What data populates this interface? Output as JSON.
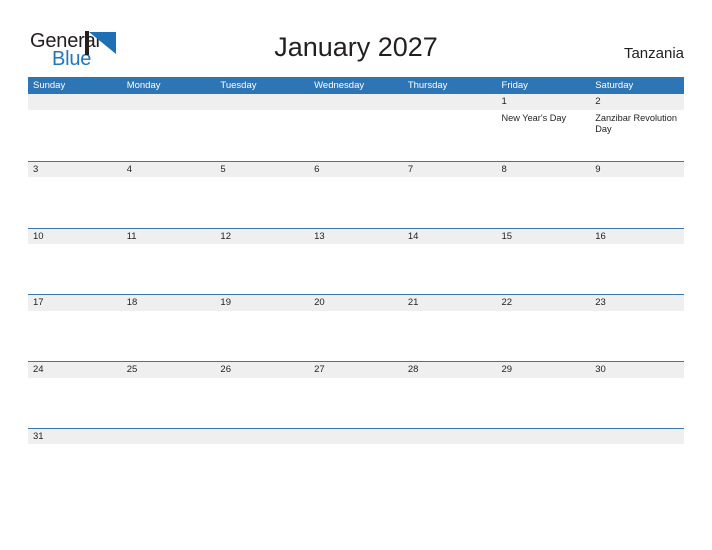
{
  "brand": {
    "name_part1": "General",
    "name_part2": "Blue",
    "mark_icon": "triangle-flag-icon",
    "colors": {
      "dark": "#231f20",
      "blue": "#2176bd"
    }
  },
  "header": {
    "title": "January 2027",
    "country": "Tanzania"
  },
  "calendar": {
    "accent_color": "#2e75b6",
    "band_color": "#efefef",
    "weekdays": [
      "Sunday",
      "Monday",
      "Tuesday",
      "Wednesday",
      "Thursday",
      "Friday",
      "Saturday"
    ],
    "weeks": [
      [
        {
          "day": "",
          "events": []
        },
        {
          "day": "",
          "events": []
        },
        {
          "day": "",
          "events": []
        },
        {
          "day": "",
          "events": []
        },
        {
          "day": "",
          "events": []
        },
        {
          "day": "1",
          "events": [
            "New Year's Day"
          ]
        },
        {
          "day": "2",
          "events": [
            "Zanzibar Revolution Day"
          ]
        }
      ],
      [
        {
          "day": "3",
          "events": []
        },
        {
          "day": "4",
          "events": []
        },
        {
          "day": "5",
          "events": []
        },
        {
          "day": "6",
          "events": []
        },
        {
          "day": "7",
          "events": []
        },
        {
          "day": "8",
          "events": []
        },
        {
          "day": "9",
          "events": []
        }
      ],
      [
        {
          "day": "10",
          "events": []
        },
        {
          "day": "11",
          "events": []
        },
        {
          "day": "12",
          "events": []
        },
        {
          "day": "13",
          "events": []
        },
        {
          "day": "14",
          "events": []
        },
        {
          "day": "15",
          "events": []
        },
        {
          "day": "16",
          "events": []
        }
      ],
      [
        {
          "day": "17",
          "events": []
        },
        {
          "day": "18",
          "events": []
        },
        {
          "day": "19",
          "events": []
        },
        {
          "day": "20",
          "events": []
        },
        {
          "day": "21",
          "events": []
        },
        {
          "day": "22",
          "events": []
        },
        {
          "day": "23",
          "events": []
        }
      ],
      [
        {
          "day": "24",
          "events": []
        },
        {
          "day": "25",
          "events": []
        },
        {
          "day": "26",
          "events": []
        },
        {
          "day": "27",
          "events": []
        },
        {
          "day": "28",
          "events": []
        },
        {
          "day": "29",
          "events": []
        },
        {
          "day": "30",
          "events": []
        }
      ],
      [
        {
          "day": "31",
          "events": []
        },
        {
          "day": "",
          "events": []
        },
        {
          "day": "",
          "events": []
        },
        {
          "day": "",
          "events": []
        },
        {
          "day": "",
          "events": []
        },
        {
          "day": "",
          "events": []
        },
        {
          "day": "",
          "events": []
        }
      ]
    ]
  }
}
